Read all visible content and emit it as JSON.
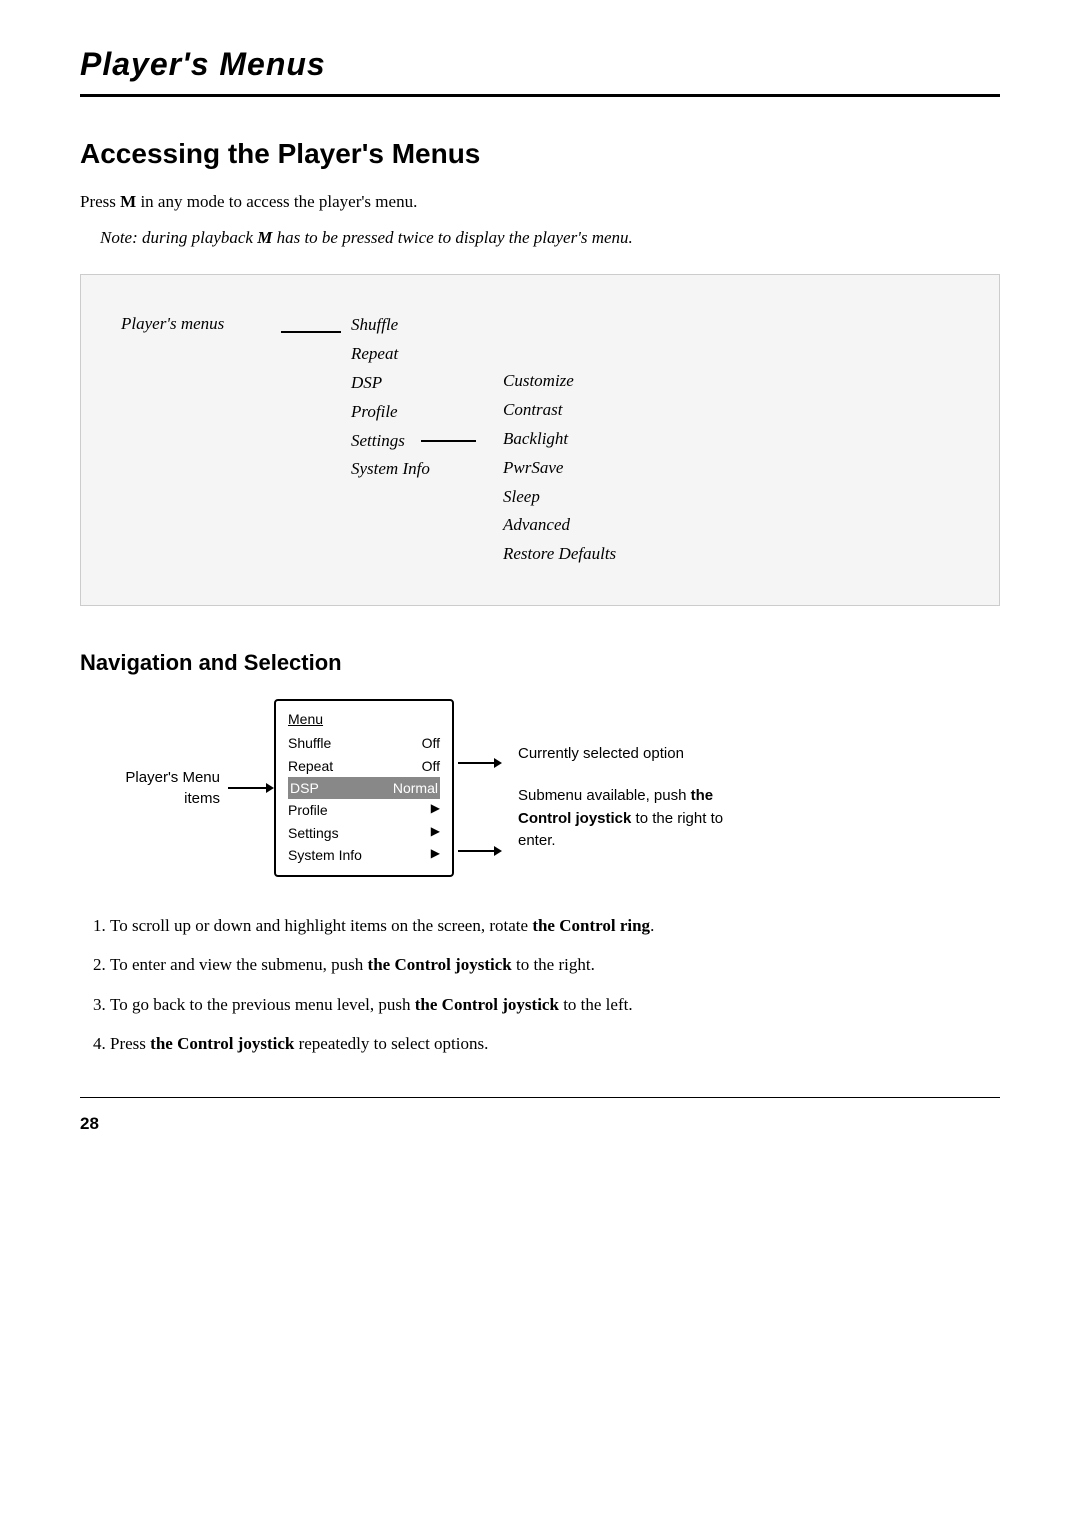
{
  "header": {
    "title": "Player's Menus"
  },
  "section": {
    "heading": "Accessing the Player's Menus",
    "intro": "Press M in any mode to access the player's menu.",
    "note": "Note: during playback M has to be pressed twice to display the player's menu."
  },
  "menu_diagram": {
    "label": "Player's menus",
    "main_items": [
      "Shuffle",
      "Repeat",
      "DSP",
      "Profile",
      "Settings",
      "System Info"
    ],
    "settings_sub": [
      "Customize",
      "Contrast",
      "Backlight",
      "PwrSave",
      "Sleep",
      "Advanced",
      "Restore Defaults"
    ]
  },
  "nav_section": {
    "heading": "Navigation and Selection",
    "screen": {
      "title": "Menu",
      "rows": [
        {
          "label": "Shuffle",
          "value": "Off",
          "highlighted": false
        },
        {
          "label": "Repeat",
          "value": "Off",
          "highlighted": false
        },
        {
          "label": "DSP",
          "value": "Normal",
          "highlighted": true
        },
        {
          "label": "Profile",
          "value": "▶",
          "highlighted": false
        },
        {
          "label": "Settings",
          "value": "▶",
          "highlighted": false
        },
        {
          "label": "System Info",
          "value": "▶",
          "highlighted": false
        }
      ]
    },
    "left_label": {
      "line1": "Player's Menu",
      "line2": "items"
    },
    "right_label_top": "Currently selected option",
    "right_label_bottom_plain": "Submenu available, push ",
    "right_label_bottom_bold": "the Control joystick",
    "right_label_bottom_end": " to the right to enter."
  },
  "numbered_items": [
    {
      "text_plain": "To scroll up or down and highlight items on the screen, rotate ",
      "text_bold": "the Control ring",
      "text_end": "."
    },
    {
      "text_plain": "To enter and view the submenu, push ",
      "text_bold": "the Control joystick",
      "text_end": " to the right."
    },
    {
      "text_plain": "To go back to the previous menu level, push ",
      "text_bold": "the Control joystick",
      "text_end": " to the left."
    },
    {
      "text_plain": "Press ",
      "text_bold": "the Control joystick",
      "text_end": " repeatedly to select options."
    }
  ],
  "page_number": "28"
}
